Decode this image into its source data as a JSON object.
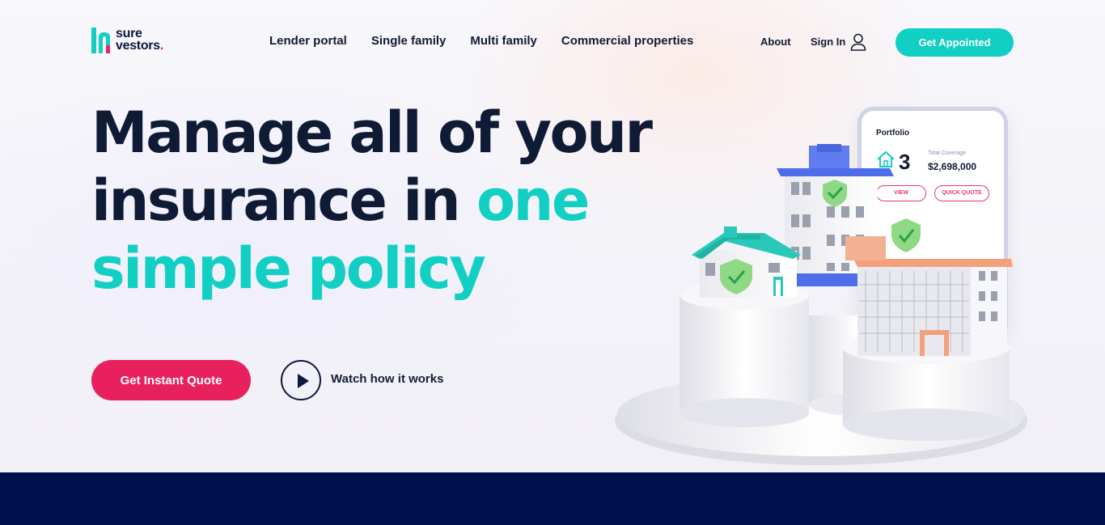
{
  "logo": {
    "line1": "sure",
    "line2": "vestors",
    "dot": "."
  },
  "nav": {
    "items": [
      {
        "label": "Lender portal"
      },
      {
        "label": "Single family"
      },
      {
        "label": "Multi family"
      },
      {
        "label": "Commercial properties"
      }
    ]
  },
  "header": {
    "about": "About",
    "sign_in": "Sign In",
    "cta": "Get Appointed"
  },
  "hero": {
    "line1": "Manage all of your",
    "line2_a": "insurance in ",
    "line2_b": "one",
    "line3": "simple policy",
    "quote_button": "Get Instant Quote",
    "watch_label": "Watch how it works"
  },
  "phone": {
    "title": "Portfolio",
    "count": "3",
    "coverage_label": "Total Coverage",
    "coverage_value": "$2,698,000",
    "view_button": "VIEW",
    "quick_quote_button": "QUICK QUOTE"
  },
  "colors": {
    "brand_teal": "#12cfc4",
    "brand_pink": "#e9205e",
    "navy": "#0f1a35",
    "footer": "#000f4d"
  },
  "icons": [
    "user-icon",
    "play-icon",
    "house-icon",
    "shield-check-icon"
  ]
}
